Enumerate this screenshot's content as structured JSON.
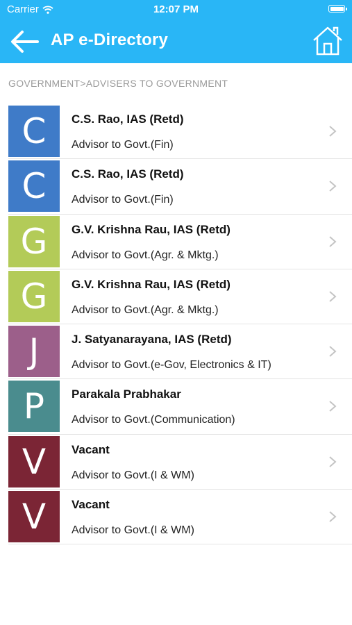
{
  "status_bar": {
    "carrier": "Carrier",
    "time": "12:07 PM"
  },
  "header": {
    "title": "AP e-Directory"
  },
  "breadcrumb": "GOVERNMENT>ADVISERS TO GOVERNMENT",
  "colors": {
    "accent": "#29b6f6",
    "avatar_c": "#3f7bc8",
    "avatar_g": "#b3cb58",
    "avatar_j": "#9c5f8a",
    "avatar_p": "#4a8c8e",
    "avatar_v": "#7b2535"
  },
  "items": [
    {
      "initial": "C",
      "name": "C.S. Rao, IAS (Retd)",
      "designation": "Advisor to Govt.(Fin)",
      "color": "#3f7bc8"
    },
    {
      "initial": "C",
      "name": "C.S. Rao, IAS (Retd)",
      "designation": "Advisor to Govt.(Fin)",
      "color": "#3f7bc8"
    },
    {
      "initial": "G",
      "name": "G.V. Krishna Rau, IAS (Retd)",
      "designation": "Advisor to Govt.(Agr. & Mktg.)",
      "color": "#b3cb58"
    },
    {
      "initial": "G",
      "name": "G.V. Krishna Rau, IAS (Retd)",
      "designation": "Advisor to Govt.(Agr. & Mktg.)",
      "color": "#b3cb58"
    },
    {
      "initial": "J",
      "name": "J. Satyanarayana, IAS (Retd)",
      "designation": "Advisor to Govt.(e-Gov, Electronics & IT)",
      "color": "#9c5f8a"
    },
    {
      "initial": "P",
      "name": "Parakala Prabhakar",
      "designation": "Advisor to Govt.(Communication)",
      "color": "#4a8c8e"
    },
    {
      "initial": "V",
      "name": "Vacant",
      "designation": "Advisor to Govt.(I & WM)",
      "color": "#7b2535"
    },
    {
      "initial": "V",
      "name": "Vacant",
      "designation": "Advisor to Govt.(I & WM)",
      "color": "#7b2535"
    }
  ]
}
